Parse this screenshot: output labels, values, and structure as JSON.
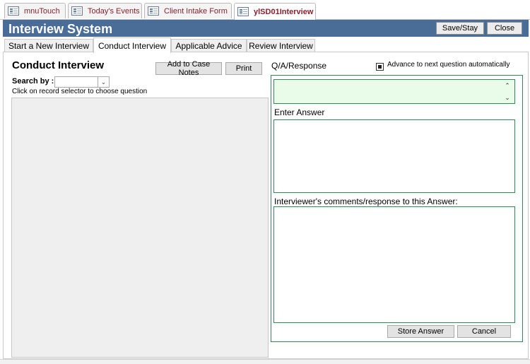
{
  "doc_tabs": [
    {
      "label": "mnuTouch",
      "active": false
    },
    {
      "label": "Today's Events",
      "active": false
    },
    {
      "label": "Client Intake Form",
      "active": false
    },
    {
      "label": "ylSD01Interview",
      "active": true
    }
  ],
  "header": {
    "title": "Interview System",
    "save_stay_label": "Save/Stay",
    "close_label": "Close"
  },
  "form_tabs": [
    {
      "label": "Start a New Interview",
      "active": false
    },
    {
      "label": "Conduct Interview",
      "active": true
    },
    {
      "label": "Applicable Advice",
      "active": false
    },
    {
      "label": "Review Interview",
      "active": false
    }
  ],
  "conduct": {
    "title": "Conduct Interview",
    "add_case_notes_label": "Add to Case Notes",
    "print_label": "Print",
    "search_by_label": "Search by :",
    "search_by_value": "",
    "instruction": "Click on record selector to choose question"
  },
  "qa": {
    "label": "Q/A/Response",
    "advance_label": "Advance to next question automatically",
    "advance_checked": true,
    "question_text": "",
    "enter_answer_label": "Enter Answer",
    "answer_value": "",
    "comments_label": "Interviewer's comments/response to this Answer:",
    "comments_value": "",
    "store_answer_label": "Store Answer",
    "cancel_label": "Cancel"
  },
  "colors": {
    "header_bg": "#4a6d97",
    "tab_text": "#8a1f2c",
    "panel_border": "#2e8b57",
    "qa_bg": "#e9fbe9"
  }
}
